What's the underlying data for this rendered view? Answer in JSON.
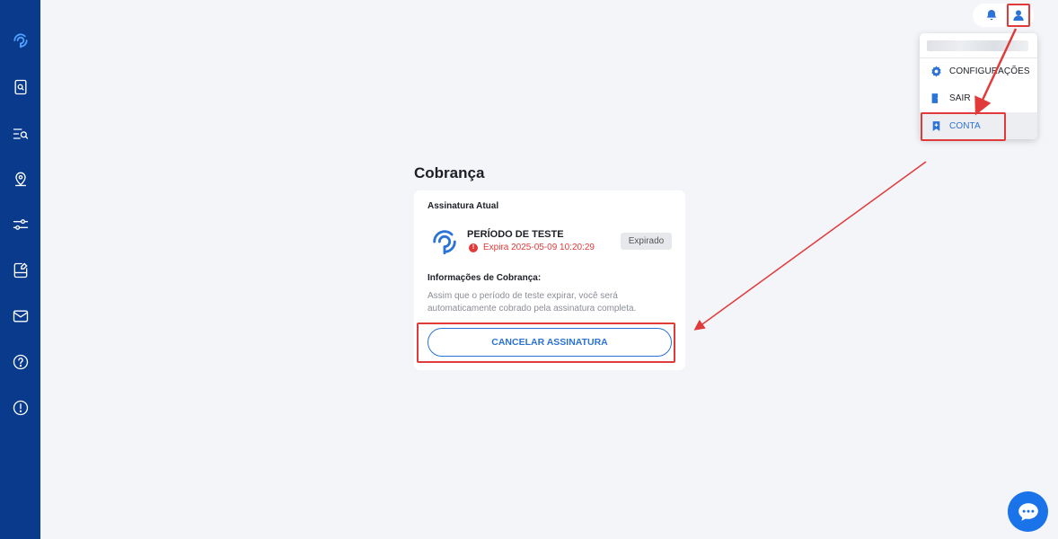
{
  "sidebar": {
    "items": [
      {
        "icon": "brand-logo-icon"
      },
      {
        "icon": "document-search-icon"
      },
      {
        "icon": "list-search-icon"
      },
      {
        "icon": "map-pin-icon"
      },
      {
        "icon": "sliders-icon"
      },
      {
        "icon": "document-edit-icon"
      },
      {
        "icon": "mail-forward-icon"
      },
      {
        "icon": "help-icon"
      },
      {
        "icon": "alert-icon"
      }
    ]
  },
  "header": {
    "notifications_icon": "bell-icon",
    "account_icon": "user-icon"
  },
  "user_menu": {
    "items": [
      {
        "label": "CONFIGURAÇÕES",
        "icon": "gear-icon"
      },
      {
        "label": "SAIR",
        "icon": "logout-icon"
      },
      {
        "label": "CONTA",
        "icon": "bookmark-icon"
      }
    ]
  },
  "billing": {
    "title": "Cobrança",
    "current_subscription_heading": "Assinatura Atual",
    "plan_name": "PERÍODO DE TESTE",
    "expiry_text": "Expira 2025-05-09 10:20:29",
    "status": "Expirado",
    "billing_info_heading": "Informações de Cobrança:",
    "billing_info_text": "Assim que o período de teste expirar, você será automaticamente cobrado pela assinatura completa.",
    "cancel_button_label": "CANCELAR ASSINATURA"
  },
  "colors": {
    "sidebar": "#0a3a8c",
    "accent": "#2b73d6",
    "highlight": "#e03a3a"
  }
}
